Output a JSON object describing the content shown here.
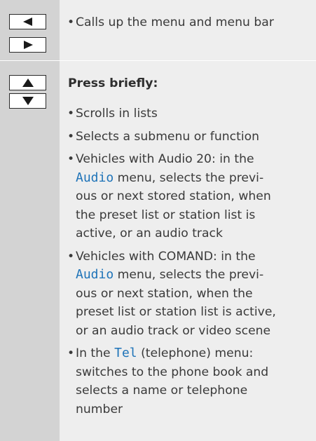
{
  "row_nav": {
    "keys": [
      {
        "icon": "left-arrow-key-icon"
      },
      {
        "icon": "right-arrow-key-icon"
      }
    ],
    "items": [
      "Calls up the menu and menu bar"
    ]
  },
  "row_scroll": {
    "keys": [
      {
        "icon": "up-arrow-key-icon"
      },
      {
        "icon": "down-arrow-key-icon"
      }
    ],
    "heading": "Press briefly:",
    "item1": "Scrolls in lists",
    "item2": "Selects a submenu or function",
    "item3": {
      "l1": "Vehicles with Audio 20: in the",
      "menu": "Audio",
      "l2_rest": " menu, selects the previ-",
      "l3": "ous or next stored station, when",
      "l4": "the preset list or station list is",
      "l5": "active, or an audio track"
    },
    "item4": {
      "l1": "Vehicles with COMAND: in the",
      "menu": "Audio",
      "l2_rest": " menu, selects the previ-",
      "l3": "ous or next station, when the",
      "l4": "preset list or station list is active,",
      "l5": "or an audio track or video scene"
    },
    "item5": {
      "l1_pre": "In the ",
      "menu": "Tel",
      "l1_rest": " (telephone) menu:",
      "l2": "switches to the phone book and",
      "l3": "selects a name or telephone",
      "l4": "number"
    }
  },
  "colors": {
    "key_column_bg": "#d3d3d3",
    "description_bg": "#eeeeee",
    "menu_highlight": "#1e73b8",
    "text": "#3a3a3a"
  }
}
